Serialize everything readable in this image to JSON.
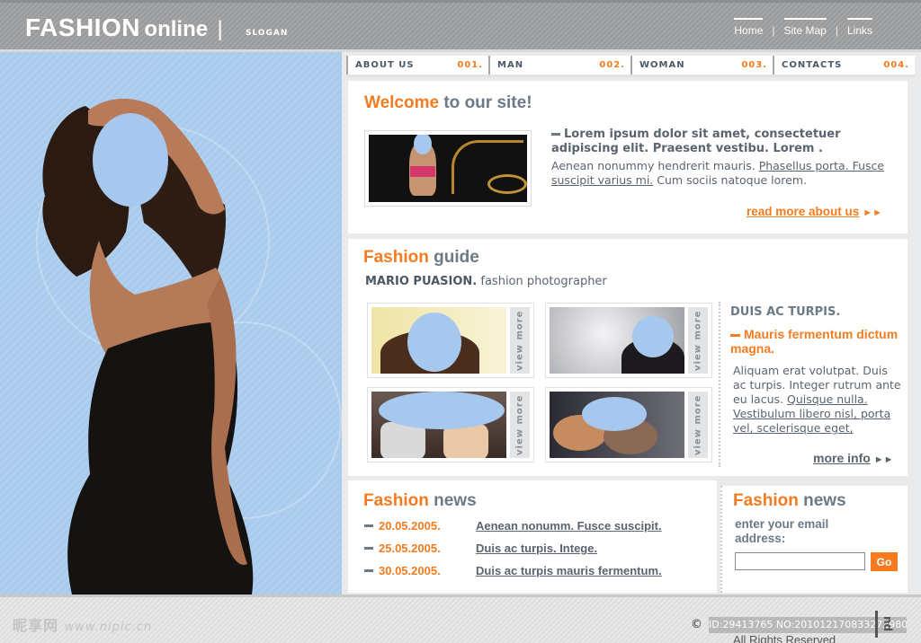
{
  "header": {
    "logo_main": "FASHION",
    "logo_sub": "online",
    "logo_bar": "|",
    "slogan": "SLOGAN",
    "links": [
      "Home",
      "Site Map",
      "Links"
    ],
    "link_sep": "|"
  },
  "nav": [
    {
      "label": "ABOUT US",
      "num": "001."
    },
    {
      "label": "MAN",
      "num": "002."
    },
    {
      "label": "WOMAN",
      "num": "003."
    },
    {
      "label": "CONTACTS",
      "num": "004."
    }
  ],
  "welcome": {
    "title_orange": "Welcome",
    "title_gray": "to our site!",
    "lead": "Lorem ipsum dolor sit amet, consectetuer adipiscing elit. Praesent vestibu. Lorem .",
    "body_plain": "Aenean nonummy hendrerit mauris.",
    "body_link": "Phasellus porta. Fusce suscipit varius mi.",
    "body_tail": "Cum sociis natoque lorem.",
    "read_more": "read more about us"
  },
  "guide": {
    "title_orange": "Fashion",
    "title_gray": "guide",
    "photographer_name": "MARIO PUASION.",
    "photographer_role": "fashion photographer",
    "view_more": "view more",
    "side_title": "DUIS AC TURPIS.",
    "side_orange": "Mauris fermentum dictum magna.",
    "side_body_plain": "Aliquam erat volutpat. Duis ac turpis. Integer rutrum ante eu lacus.",
    "side_body_link": "Quisque nulla. Vestibulum libero nisl, porta vel, scelerisque eget,",
    "more_info": "more info"
  },
  "news": {
    "title_orange": "Fashion",
    "title_gray": "news",
    "items": [
      {
        "date": "20.05.2005.",
        "text": "Aenean nonumm. Fusce suscipit."
      },
      {
        "date": "25.05.2005.",
        "text": "Duis ac turpis. Intege."
      },
      {
        "date": "30.05.2005.",
        "text": "Duis ac turpis mauris fermentum."
      }
    ]
  },
  "newsletter": {
    "title_orange": "Fashion",
    "title_gray": "news",
    "label": "enter your email address:",
    "email_value": "",
    "go_label": "Go"
  },
  "footer": {
    "watermark_cn": "昵享网",
    "watermark_url": "www.nipic.cn",
    "copyright": "©",
    "id_text": "ID:29413765 NO:20101217083327298000",
    "rights": "All Rights Reserved",
    "side_mark": "nd"
  },
  "colors": {
    "accent": "#f47b20",
    "text_gray": "#6c7a86",
    "left_panel_blue": "#a9cbed",
    "header_gray": "#a0a1a3"
  }
}
